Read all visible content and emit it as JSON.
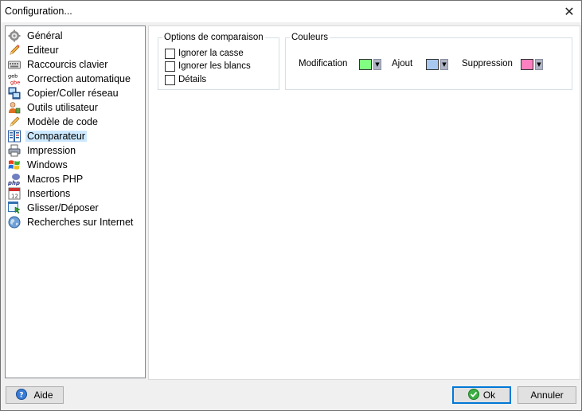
{
  "window": {
    "title": "Configuration..."
  },
  "sidebar": {
    "items": [
      {
        "label": "Général",
        "icon": "gear-icon"
      },
      {
        "label": "Editeur",
        "icon": "pencil-icon"
      },
      {
        "label": "Raccourcis clavier",
        "icon": "keyboard-icon"
      },
      {
        "label": "Correction automatique",
        "icon": "spellcheck-icon",
        "icon_text": "geb gbe"
      },
      {
        "label": "Copier/Coller réseau",
        "icon": "network-copy-icon"
      },
      {
        "label": "Outils utilisateur",
        "icon": "user-tools-icon"
      },
      {
        "label": "Modèle de code",
        "icon": "code-template-icon"
      },
      {
        "label": "Comparateur",
        "icon": "compare-icon",
        "selected": true
      },
      {
        "label": "Impression",
        "icon": "printer-icon"
      },
      {
        "label": "Windows",
        "icon": "windows-logo-icon"
      },
      {
        "label": "Macros PHP",
        "icon": "php-icon",
        "icon_text": "php"
      },
      {
        "label": "Insertions",
        "icon": "calendar-icon",
        "icon_text": "12"
      },
      {
        "label": "Glisser/Déposer",
        "icon": "drag-drop-icon"
      },
      {
        "label": "Recherches sur Internet",
        "icon": "globe-icon"
      }
    ]
  },
  "compare_options": {
    "title": "Options de comparaison",
    "options": [
      {
        "label": "Ignorer la casse",
        "checked": false
      },
      {
        "label": "Ignorer les blancs",
        "checked": false
      },
      {
        "label": "Détails",
        "checked": false
      }
    ]
  },
  "colors": {
    "title": "Couleurs",
    "items": [
      {
        "label": "Modification",
        "color": "#80ff80"
      },
      {
        "label": "Ajout",
        "color": "#a8c8f0"
      },
      {
        "label": "Suppression",
        "color": "#ff80c0"
      }
    ]
  },
  "footer": {
    "help_label": "Aide",
    "ok_label": "Ok",
    "cancel_label": "Annuler"
  }
}
